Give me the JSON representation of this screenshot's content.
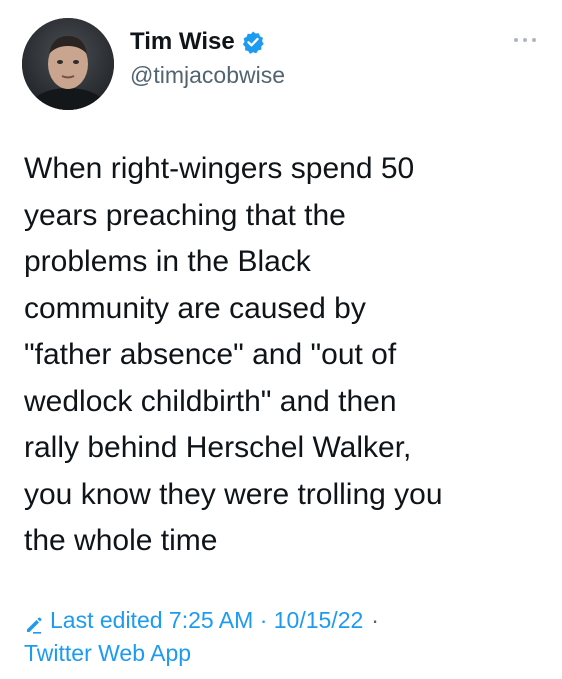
{
  "author": {
    "display_name": "Tim Wise",
    "handle": "@timjacobwise",
    "verified": true
  },
  "tweet": {
    "text": "When right-wingers spend 50\nyears preaching that the\nproblems in the Black\ncommunity are caused by\n\"father absence\" and \"out of\nwedlock childbirth\" and then\nrally behind Herschel Walker,\nyou know they were trolling you\nthe whole time"
  },
  "meta": {
    "edited_label": "Last edited 7:25 AM · 10/15/22",
    "separator": "·",
    "source": "Twitter Web App"
  },
  "icons": {
    "verified": "verified-badge-icon",
    "more": "more-options-icon",
    "edit": "pencil-icon"
  },
  "colors": {
    "accent": "#1d9bf0",
    "text": "#0f1419",
    "secondary": "#536471"
  }
}
